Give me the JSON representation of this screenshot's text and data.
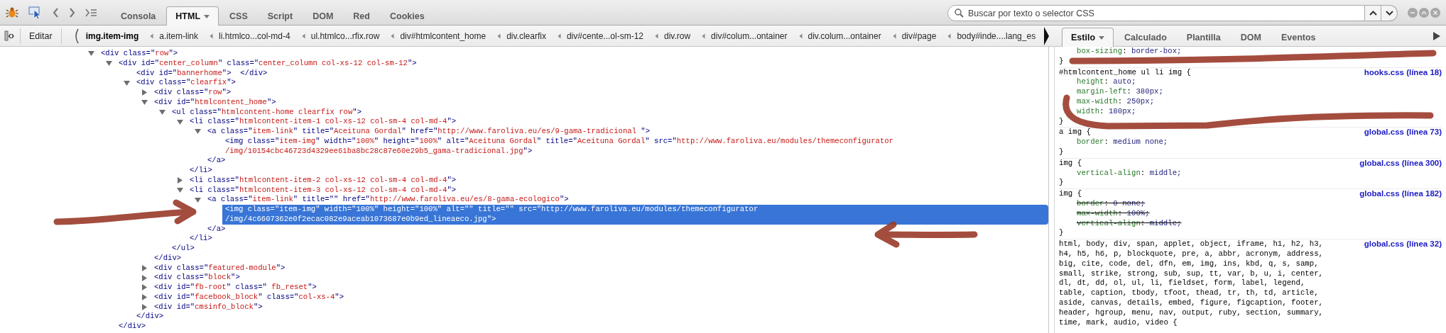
{
  "toolbar": {
    "tabs": [
      {
        "label": "Consola",
        "selected": false,
        "has_menu": false
      },
      {
        "label": "HTML",
        "selected": true,
        "has_menu": true
      },
      {
        "label": "CSS",
        "selected": false,
        "has_menu": false
      },
      {
        "label": "Script",
        "selected": false,
        "has_menu": false
      },
      {
        "label": "DOM",
        "selected": false,
        "has_menu": false
      },
      {
        "label": "Red",
        "selected": false,
        "has_menu": false
      },
      {
        "label": "Cookies",
        "selected": false,
        "has_menu": false
      }
    ],
    "search": {
      "placeholder": "Buscar por texto o selector CSS"
    }
  },
  "breadcrumb": {
    "edit_button": "Editar",
    "items": [
      {
        "label": "img.item-img",
        "selected": true
      },
      {
        "label": "a.item-link",
        "selected": false
      },
      {
        "label": "li.htmlco...col-md-4",
        "selected": false
      },
      {
        "label": "ul.htmlco...rfix.row",
        "selected": false
      },
      {
        "label": "div#htmlcontent_home",
        "selected": false
      },
      {
        "label": "div.clearfix",
        "selected": false
      },
      {
        "label": "div#cente...ol-sm-12",
        "selected": false
      },
      {
        "label": "div.row",
        "selected": false
      },
      {
        "label": "div#colum...ontainer",
        "selected": false
      },
      {
        "label": "div.colum...ontainer",
        "selected": false
      },
      {
        "label": "div#page",
        "selected": false
      },
      {
        "label": "body#inde....lang_es",
        "selected": false
      }
    ]
  },
  "side_tabs": [
    {
      "label": "Estilo",
      "selected": true,
      "has_menu": true
    },
    {
      "label": "Calculado",
      "selected": false,
      "has_menu": false
    },
    {
      "label": "Plantilla",
      "selected": false,
      "has_menu": false
    },
    {
      "label": "DOM",
      "selected": false,
      "has_menu": false
    },
    {
      "label": "Eventos",
      "selected": false,
      "has_menu": false
    }
  ],
  "tree": [
    {
      "text": "<div class=\"row\">",
      "expanded": true,
      "selected": false,
      "children": [
        {
          "text": "<div id=\"center_column\" class=\"center_column col-xs-12 col-sm-12\">",
          "expanded": true,
          "selected": false,
          "close": "</div>",
          "children": [
            {
              "text": "<div id=\"bannerhome\">  </div>",
              "selected": false
            },
            {
              "text": "<div class=\"clearfix\">",
              "expanded": true,
              "selected": false,
              "close": "</div>",
              "children": [
                {
                  "text": "<div class=\"row\">",
                  "expanded": false,
                  "selected": false
                },
                {
                  "text": "<div id=\"htmlcontent_home\">",
                  "expanded": true,
                  "selected": false,
                  "close": "</div>",
                  "children": [
                    {
                      "text": "<ul class=\"htmlcontent-home clearfix row\">",
                      "expanded": true,
                      "selected": false,
                      "close": "</ul>",
                      "children": [
                        {
                          "text": "<li class=\"htmlcontent-item-1 col-xs-12 col-sm-4 col-md-4\">",
                          "expanded": true,
                          "selected": false,
                          "close": "</li>",
                          "children": [
                            {
                              "text": "<a class=\"item-link\" title=\"Aceituna Gordal\" href=\"http://www.faroliva.eu/es/9-gama-tradicional \">",
                              "expanded": true,
                              "selected": false,
                              "close": "</a>",
                              "children": [
                                {
                                  "text": "<img class=\"item-img\" width=\"100%\" height=\"100%\" alt=\"Aceituna Gordal\" title=\"Aceituna Gordal\" src=\"http://www.faroliva.eu/modules/themeconfigurator",
                                  "wrap": "/img/10154cbc46723d4329ee61ba8bc28c87e60e29b5_gama-tradicional.jpg\">",
                                  "selected": false
                                }
                              ]
                            }
                          ]
                        },
                        {
                          "text": "<li class=\"htmlcontent-item-2 col-xs-12 col-sm-4 col-md-4\">",
                          "expanded": false,
                          "selected": false
                        },
                        {
                          "text": "<li class=\"htmlcontent-item-3 col-xs-12 col-sm-4 col-md-4\">",
                          "expanded": true,
                          "selected": false,
                          "close": "</li>",
                          "children": [
                            {
                              "text": "<a class=\"item-link\" title=\"\" href=\"http://www.faroliva.eu/es/8-gama-ecologico\">",
                              "expanded": true,
                              "selected": false,
                              "close": "</a>",
                              "children": [
                                {
                                  "text": "<img class=\"item-img\" width=\"100%\" height=\"100%\" alt=\"\" title=\"\" src=\"http://www.faroliva.eu/modules/themeconfigurator",
                                  "wrap": "/img/4c6607362e0f2ecac082e9aceab1073687e0b9ed_lineaeco.jpg\">",
                                  "selected": true
                                }
                              ]
                            }
                          ]
                        }
                      ]
                    }
                  ]
                },
                {
                  "text": "<div class=\"featured-module\">",
                  "expanded": false,
                  "selected": false
                },
                {
                  "text": "<div class=\"block\">",
                  "expanded": false,
                  "selected": false
                },
                {
                  "text": "<div id=\"fb-root\" class=\" fb_reset\">",
                  "expanded": false,
                  "selected": false
                },
                {
                  "text": "<div id=\"facebook_block\" class=\"col-xs-4\">",
                  "expanded": false,
                  "selected": false
                },
                {
                  "text": "<div id=\"cmsinfo_block\">",
                  "expanded": false,
                  "selected": false
                }
              ]
            }
          ]
        }
      ]
    }
  ],
  "style_rules": [
    {
      "properties": [
        {
          "text": "box-sizing: border-box;",
          "overridden": false
        }
      ],
      "close": "}"
    },
    {
      "selector": "#htmlcontent_home ul li img {",
      "source": "hooks.css (línea 18)",
      "properties": [
        {
          "text": "height: auto;",
          "overridden": false
        },
        {
          "text": "margin-left: 380px;",
          "overridden": false
        },
        {
          "text": "max-width: 250px;",
          "overridden": false
        },
        {
          "text": "width: 180px;",
          "overridden": false
        }
      ],
      "close": "}"
    },
    {
      "selector": "a img {",
      "source": "global.css (línea 73)",
      "properties": [
        {
          "text": "border: medium none;",
          "overridden": false
        }
      ],
      "close": "}"
    },
    {
      "selector": "img {",
      "source": "global.css (línea 300)",
      "properties": [
        {
          "text": "vertical-align: middle;",
          "overridden": false
        }
      ],
      "close": "}"
    },
    {
      "selector": "img {",
      "source": "global.css (línea 182)",
      "properties": [
        {
          "text": "border: 0 none;",
          "overridden": true
        },
        {
          "text": "max-width: 100%;",
          "overridden": true
        },
        {
          "text": "vertical-align: middle;",
          "overridden": true
        }
      ],
      "close": "}"
    },
    {
      "selector": "html, body, div, span, applet, object, iframe, h1, h2, h3, h4, h5, h6, p, blockquote, pre, a, abbr, acronym, address, big, cite, code, del, dfn, em, img, ins, kbd, q, s, samp, small, strike, strong, sub, sup, tt, var, b, u, i, center, dl, dt, dd, ol, ul, li, fieldset, form, label, legend, table, caption, tbody, tfoot, thead, tr, th, td, article, aside, canvas, details, embed, figure, figcaption, footer, header, hgroup, menu, nav, output, ruby, section, summary, time, mark, audio, video {",
      "source": "global.css (línea 32)"
    }
  ]
}
